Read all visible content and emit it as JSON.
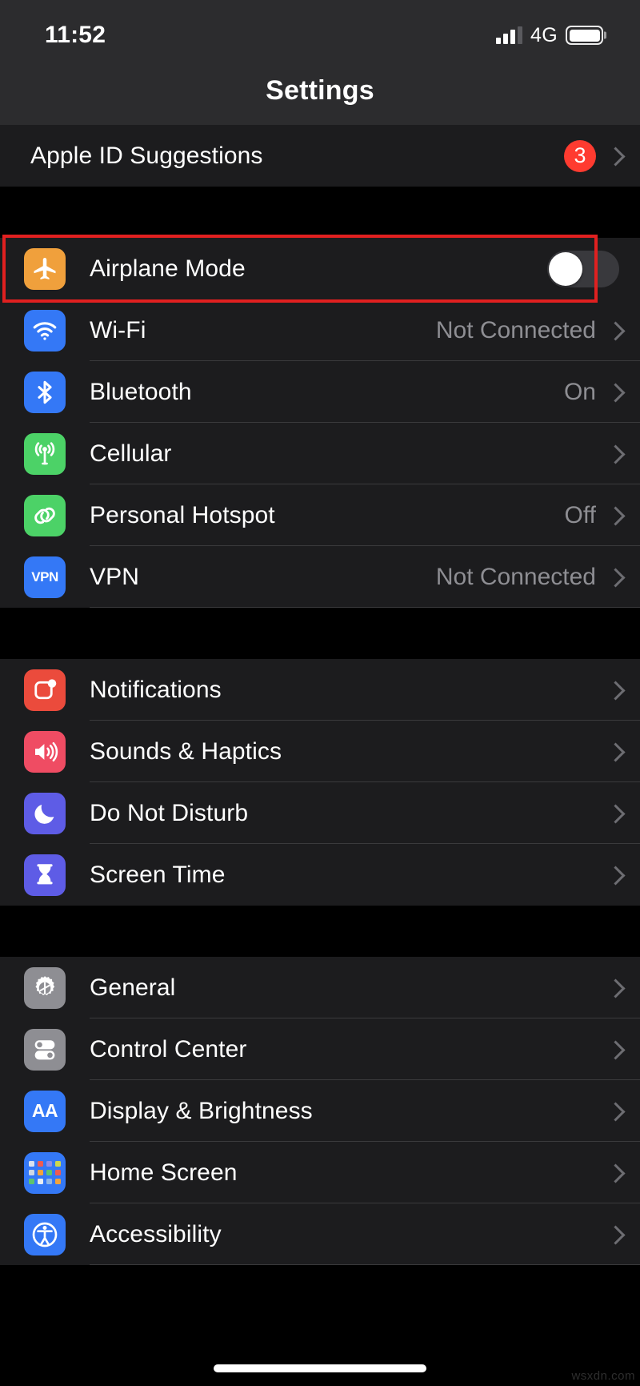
{
  "status_bar": {
    "time": "11:52",
    "network_label": "4G",
    "signal_icon": "signal-bars-icon",
    "signal_bars_filled": 3,
    "signal_bars_total": 4,
    "battery_icon": "battery-icon"
  },
  "nav": {
    "title": "Settings"
  },
  "annotation": {
    "color": "#e02020",
    "target": "airplane-mode-row"
  },
  "watermark": "wsxdn.com",
  "groups": [
    {
      "id": "suggestions",
      "rows": [
        {
          "id": "apple-id-suggestions",
          "label": "Apple ID Suggestions",
          "icon": null,
          "badge": "3",
          "accessory": "chevron"
        }
      ]
    },
    {
      "id": "connectivity",
      "rows": [
        {
          "id": "airplane-mode",
          "label": "Airplane Mode",
          "icon": "airplane-icon",
          "icon_color": "#f0a03c",
          "accessory": "toggle",
          "toggle_on": false,
          "highlighted": true
        },
        {
          "id": "wifi",
          "label": "Wi-Fi",
          "icon": "wifi-icon",
          "icon_color": "#3478f6",
          "value": "Not Connected",
          "accessory": "chevron"
        },
        {
          "id": "bluetooth",
          "label": "Bluetooth",
          "icon": "bluetooth-icon",
          "icon_color": "#3478f6",
          "value": "On",
          "accessory": "chevron"
        },
        {
          "id": "cellular",
          "label": "Cellular",
          "icon": "cellular-antenna-icon",
          "icon_color": "#4cd267",
          "value": "",
          "accessory": "chevron"
        },
        {
          "id": "personal-hotspot",
          "label": "Personal Hotspot",
          "icon": "hotspot-link-icon",
          "icon_color": "#4cd267",
          "value": "Off",
          "accessory": "chevron"
        },
        {
          "id": "vpn",
          "label": "VPN",
          "icon": "vpn-icon",
          "icon_color": "#3478f6",
          "icon_text": "VPN",
          "value": "Not Connected",
          "accessory": "chevron"
        }
      ]
    },
    {
      "id": "notifications",
      "rows": [
        {
          "id": "notifications",
          "label": "Notifications",
          "icon": "notifications-badge-icon",
          "icon_color": "#eb4b3c",
          "accessory": "chevron"
        },
        {
          "id": "sounds-haptics",
          "label": "Sounds & Haptics",
          "icon": "speaker-icon",
          "icon_color": "#ef4c63",
          "accessory": "chevron"
        },
        {
          "id": "do-not-disturb",
          "label": "Do Not Disturb",
          "icon": "moon-icon",
          "icon_color": "#5e5ce6",
          "accessory": "chevron"
        },
        {
          "id": "screen-time",
          "label": "Screen Time",
          "icon": "hourglass-icon",
          "icon_color": "#5e5ce6",
          "accessory": "chevron"
        }
      ]
    },
    {
      "id": "system",
      "rows": [
        {
          "id": "general",
          "label": "General",
          "icon": "gear-icon",
          "icon_color": "#8e8e93",
          "accessory": "chevron"
        },
        {
          "id": "control-center",
          "label": "Control Center",
          "icon": "control-center-toggles-icon",
          "icon_color": "#8e8e93",
          "accessory": "chevron"
        },
        {
          "id": "display-brightness",
          "label": "Display & Brightness",
          "icon": "display-aa-icon",
          "icon_color": "#3478f6",
          "icon_text": "AA",
          "accessory": "chevron"
        },
        {
          "id": "home-screen",
          "label": "Home Screen",
          "icon": "home-screen-grid-icon",
          "icon_color": "#3478f6",
          "accessory": "chevron"
        },
        {
          "id": "accessibility",
          "label": "Accessibility",
          "icon": "accessibility-person-icon",
          "icon_color": "#3478f6",
          "accessory": "chevron"
        }
      ]
    }
  ]
}
